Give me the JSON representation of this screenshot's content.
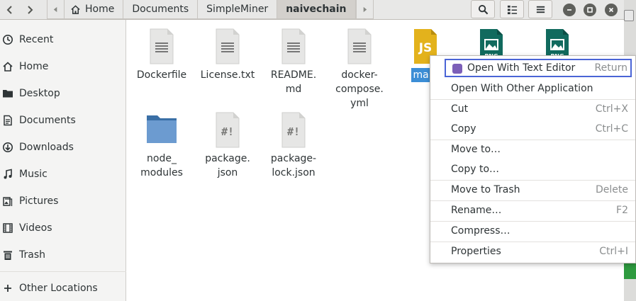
{
  "breadcrumbs": [
    {
      "label": "Home"
    },
    {
      "label": "Documents"
    },
    {
      "label": "SimpleMiner"
    },
    {
      "label": "naivechain"
    }
  ],
  "sidebar": {
    "items": [
      {
        "label": "Recent",
        "icon": "clock-icon"
      },
      {
        "label": "Home",
        "icon": "home-icon"
      },
      {
        "label": "Desktop",
        "icon": "folder-icon"
      },
      {
        "label": "Documents",
        "icon": "document-icon"
      },
      {
        "label": "Downloads",
        "icon": "download-icon"
      },
      {
        "label": "Music",
        "icon": "music-icon"
      },
      {
        "label": "Pictures",
        "icon": "picture-icon"
      },
      {
        "label": "Videos",
        "icon": "video-icon"
      },
      {
        "label": "Trash",
        "icon": "trash-icon"
      }
    ],
    "other_locations": "Other Locations"
  },
  "files": [
    {
      "label": "Dockerfile",
      "kind": "text"
    },
    {
      "label": "License.txt",
      "kind": "text"
    },
    {
      "label": "README.\nmd",
      "kind": "text"
    },
    {
      "label": "docker-\ncompose.\nyml",
      "kind": "text"
    },
    {
      "label": "main",
      "kind": "js",
      "icon_text": "JS",
      "selected": true
    },
    {
      "label": "",
      "kind": "image",
      "icon_text": "PNG"
    },
    {
      "label": "",
      "kind": "image",
      "icon_text": "PNG"
    },
    {
      "label": "node_\nmodules",
      "kind": "folder"
    },
    {
      "label": "package.\njson",
      "kind": "script",
      "icon_text": "#!"
    },
    {
      "label": "package-\nlock.json",
      "kind": "script",
      "icon_text": "#!"
    }
  ],
  "context_menu": {
    "items": [
      {
        "label": "Open With Text Editor",
        "accel": "Return"
      },
      {
        "label": "Open With Other Application",
        "accel": ""
      },
      {
        "label": "Cut",
        "accel": "Ctrl+X"
      },
      {
        "label": "Copy",
        "accel": "Ctrl+C"
      },
      {
        "label": "Move to…",
        "accel": ""
      },
      {
        "label": "Copy to…",
        "accel": ""
      },
      {
        "label": "Move to Trash",
        "accel": "Delete"
      },
      {
        "label": "Rename…",
        "accel": "F2"
      },
      {
        "label": "Compress…",
        "accel": ""
      },
      {
        "label": "Properties",
        "accel": "Ctrl+I"
      }
    ]
  },
  "colors": {
    "selection": "#3c8ed6",
    "highlight_border": "#4a64d6",
    "js_icon": "#e3b21c",
    "image_icon": "#116a5e",
    "folder": "#4f82b7"
  }
}
